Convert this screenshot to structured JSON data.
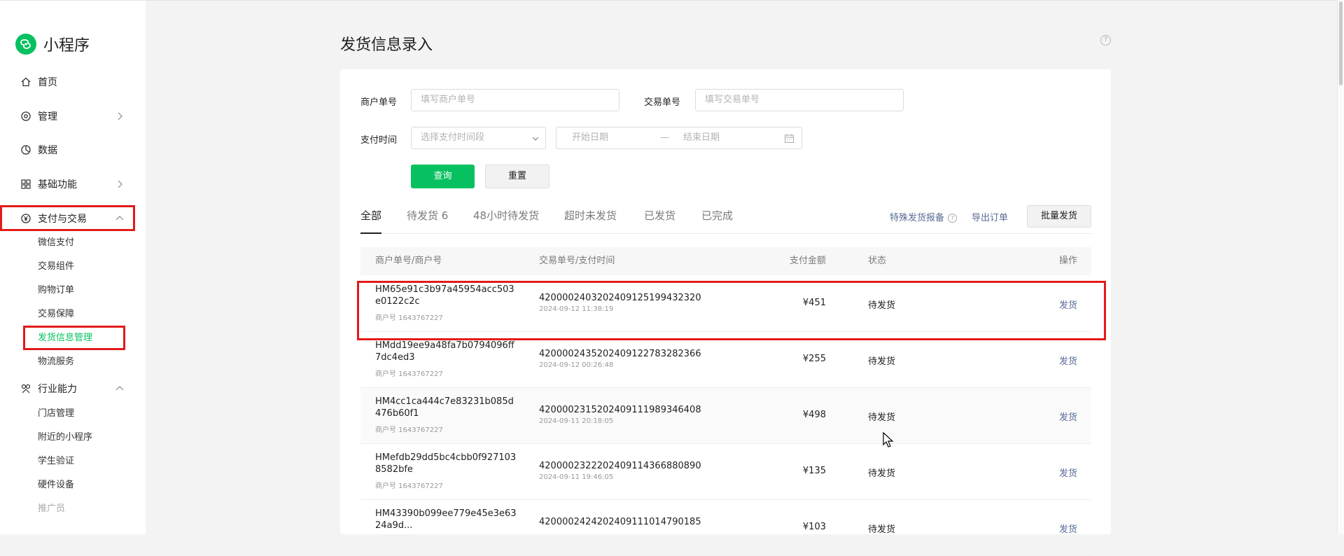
{
  "app": {
    "brand_name": "小程序"
  },
  "sidebar": {
    "items": [
      {
        "label": "首页",
        "icon": "home-icon"
      },
      {
        "label": "管理",
        "icon": "gear-icon",
        "chevron": "right"
      },
      {
        "label": "数据",
        "icon": "chart-pie-icon"
      },
      {
        "label": "基础功能",
        "icon": "grid-icon",
        "chevron": "right"
      },
      {
        "label": "支付与交易",
        "icon": "yen-circle-icon",
        "chevron": "up"
      }
    ],
    "payment_sub": [
      "微信支付",
      "交易组件",
      "购物订单",
      "交易保障",
      "发货信息管理",
      "物流服务"
    ],
    "active_sub": "发货信息管理",
    "industry": {
      "label": "行业能力",
      "icon": "industry-icon",
      "chevron": "up"
    },
    "industry_sub": [
      "门店管理",
      "附近的小程序",
      "学生验证",
      "硬件设备",
      "推广员"
    ]
  },
  "page": {
    "title": "发货信息录入",
    "help": "?"
  },
  "filters": {
    "merchant_label": "商户单号",
    "merchant_placeholder": "填写商户单号",
    "txn_label": "交易单号",
    "txn_placeholder": "填写交易单号",
    "pay_time_label": "支付时间",
    "pay_time_select": "选择支付时间段",
    "start_date": "开始日期",
    "date_sep": "—",
    "end_date": "结束日期",
    "query_btn": "查询",
    "reset_btn": "重置"
  },
  "tabs": [
    {
      "label": "全部",
      "active": true
    },
    {
      "label": "待发货 6"
    },
    {
      "label": "48小时待发货"
    },
    {
      "label": "超时未发货"
    },
    {
      "label": "已发货"
    },
    {
      "label": "已完成"
    }
  ],
  "actions": {
    "special_report": "特殊发货报备",
    "export": "导出订单",
    "batch_ship": "批量发货"
  },
  "table": {
    "headers": {
      "merchant": "商户单号/商户号",
      "txn": "交易单号/支付时间",
      "amount": "支付金额",
      "status": "状态",
      "op": "操作"
    },
    "rows": [
      {
        "merchant_no": "HM65e91c3b97a45954acc503e0122c2c",
        "merchant_id": "商户号 1643767227",
        "txn_no": "4200002403202409125199432320",
        "pay_time": "2024-09-12 11:38:19",
        "amount": "¥451",
        "status": "待发货",
        "op": "发货"
      },
      {
        "merchant_no": "HMdd19ee9a48fa7b0794096ff7dc4ed3",
        "merchant_id": "商户号 1643767227",
        "txn_no": "4200002435202409122783282366",
        "pay_time": "2024-09-12 00:26:48",
        "amount": "¥255",
        "status": "待发货",
        "op": "发货"
      },
      {
        "merchant_no": "HM4cc1ca444c7e83231b085d476b60f1",
        "merchant_id": "商户号 1643767227",
        "txn_no": "4200002315202409111989346408",
        "pay_time": "2024-09-11 20:18:05",
        "amount": "¥498",
        "status": "待发货",
        "op": "发货"
      },
      {
        "merchant_no": "HMefdb29dd5bc4cbb0f9271038582bfe",
        "merchant_id": "商户号 1643767227",
        "txn_no": "4200002322202409114366880890",
        "pay_time": "2024-09-11 19:46:05",
        "amount": "¥135",
        "status": "待发货",
        "op": "发货"
      },
      {
        "merchant_no": "HM43390b099ee779e45e3e6324a9d...",
        "merchant_id": "",
        "txn_no": "4200002424202409111014790185",
        "pay_time": "",
        "amount": "¥103",
        "status": "待发货",
        "op": "发货"
      }
    ]
  },
  "colors": {
    "brand_green": "#07c160",
    "link_blue": "#576b95",
    "highlight_red": "#e21b1b"
  }
}
